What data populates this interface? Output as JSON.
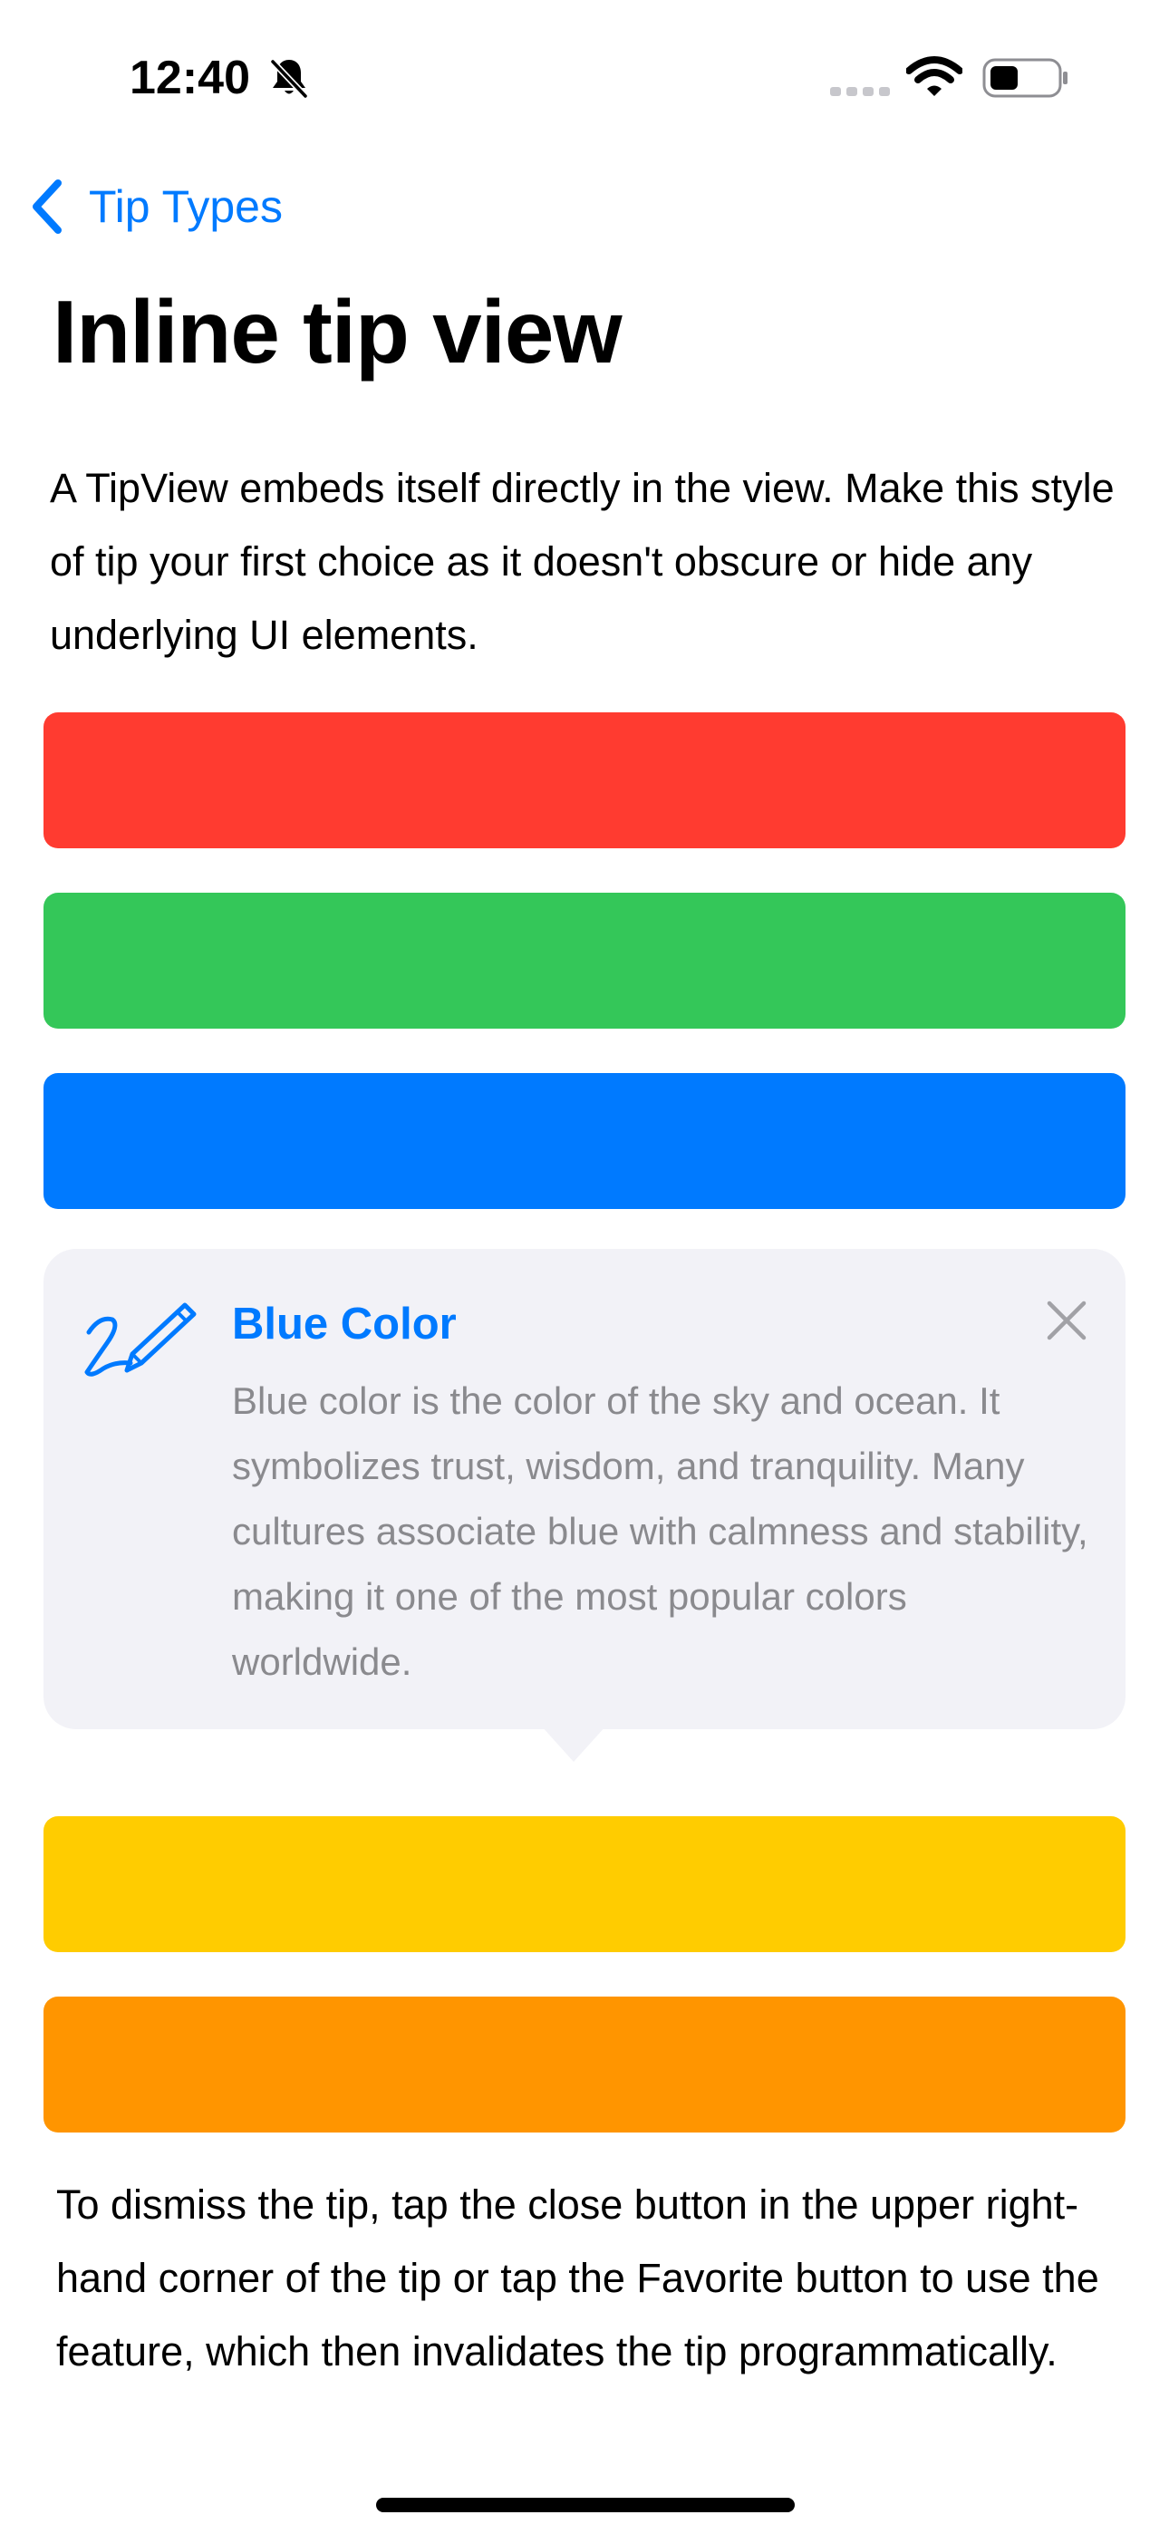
{
  "status_bar": {
    "time": "12:40",
    "icons": [
      "bell-slash-icon",
      "cellular-icon",
      "wifi-icon",
      "battery-icon"
    ]
  },
  "nav": {
    "back_label": "Tip Types",
    "back_icon": "chevron-left-icon"
  },
  "page": {
    "title": "Inline tip view",
    "intro": "A TipView embeds itself directly in the view. Make this style of tip your first choice as it doesn't obscure or hide any underlying UI elements.",
    "outro": "To dismiss the tip, tap the close button in the upper right-hand corner of the tip or tap the Favorite button to use the feature, which then invalidates the tip programmatically."
  },
  "colors": {
    "accent": "#007aff",
    "bars": [
      "#ff3b30",
      "#34c759",
      "#007aff",
      "#ffcc00",
      "#ff9500"
    ]
  },
  "tip": {
    "icon": "pencil-scribble-icon",
    "title": "Blue Color",
    "body": "Blue color is the color of the sky and ocean. It symbolizes trust, wisdom, and tranquility. Many cultures associate blue with calmness and stability, making it one of the most popular colors worldwide.",
    "close_icon": "close-icon"
  }
}
